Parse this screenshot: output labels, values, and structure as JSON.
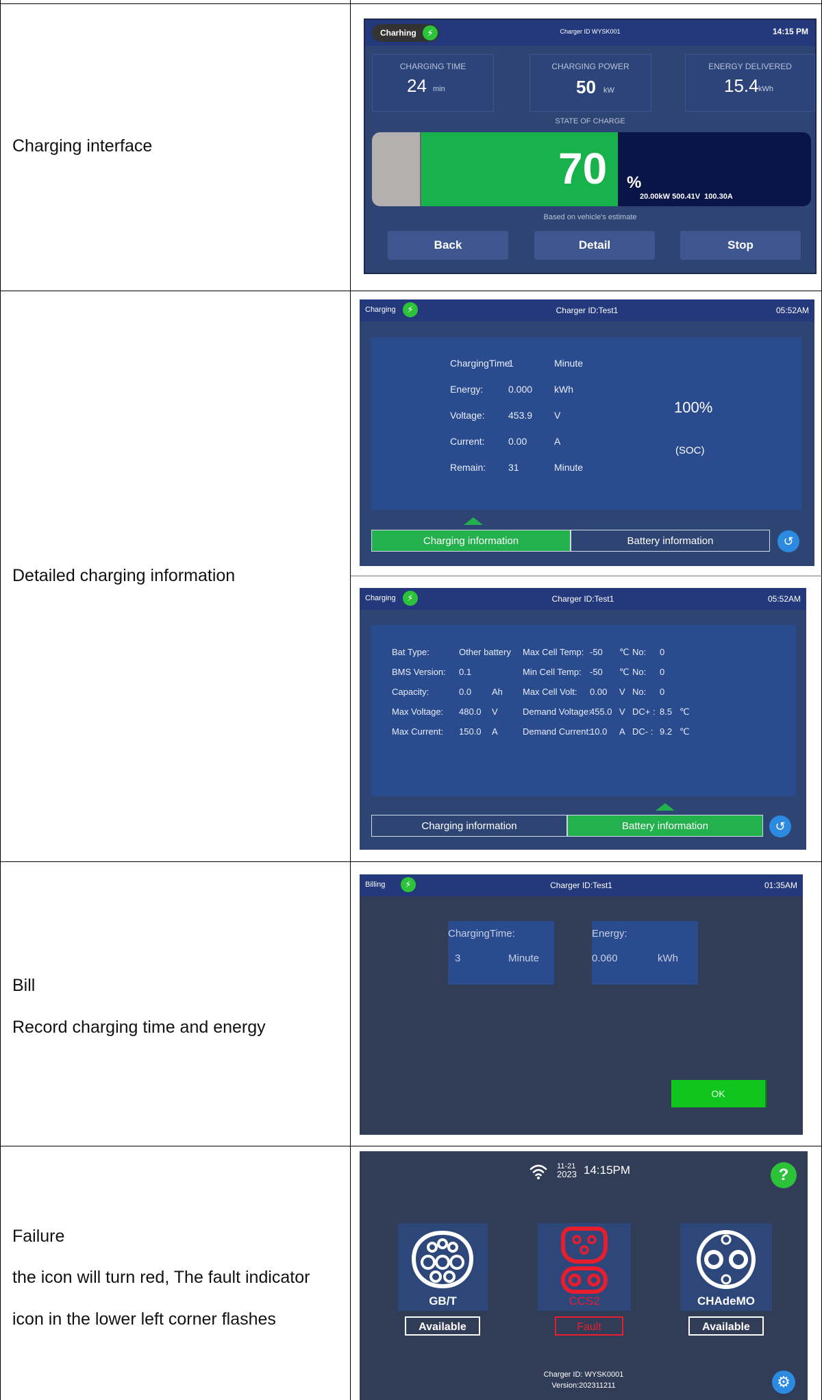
{
  "rows": [
    {
      "labels": [
        "Charging interface"
      ]
    },
    {
      "labels": [
        "Detailed charging information"
      ]
    },
    {
      "labels": [
        "Bill",
        "Record charging time and energy"
      ]
    },
    {
      "labels": [
        "Failure",
        "the icon will turn red, The fault indicator",
        "icon in the lower left corner flashes"
      ]
    }
  ],
  "screen1": {
    "status": "Charhing",
    "charger_id": "Charger ID WYSK001",
    "time": "14:15 PM",
    "cards": [
      {
        "label": "CHARGING TIME",
        "value": "24",
        "unit": "min"
      },
      {
        "label": "CHARGING POWER",
        "value": "50",
        "unit": "kW"
      },
      {
        "label": "ENERGY DELIVERED",
        "value": "15.4",
        "unit": "kWh"
      }
    ],
    "soc_label": "STATE OF CHARGE",
    "soc_value": "70",
    "soc_percent": 70,
    "soc_unit": "%",
    "readings": "20.00kW 500.41V  100.30A",
    "estimate": "Based on vehicle's estimate",
    "buttons": [
      "Back",
      "Detail",
      "Stop"
    ]
  },
  "screen2": {
    "status": "Charging",
    "charger_id": "Charger ID:Test1",
    "time": "05:52AM",
    "rows": [
      {
        "label": "ChargingTime:",
        "value": "1",
        "unit": "Minute"
      },
      {
        "label": "Energy:",
        "value": "0.000",
        "unit": "kWh"
      },
      {
        "label": "Voltage:",
        "value": "453.9",
        "unit": "V"
      },
      {
        "label": "Current:",
        "value": "0.00",
        "unit": "A"
      },
      {
        "label": "Remain:",
        "value": "31",
        "unit": "Minute"
      }
    ],
    "soc": "100%",
    "soc_label": "(SOC)",
    "tab_charging": "Charging information",
    "tab_battery": "Battery information"
  },
  "screen3": {
    "status": "Charging",
    "charger_id": "Charger ID:Test1",
    "time": "05:52AM",
    "left": [
      {
        "label": "Bat Type:",
        "value": "Other battery",
        "unit": ""
      },
      {
        "label": "BMS Version:",
        "value": "0.1",
        "unit": ""
      },
      {
        "label": "Capacity:",
        "value": "0.0",
        "unit": "Ah"
      },
      {
        "label": "Max Voltage:",
        "value": "480.0",
        "unit": "V"
      },
      {
        "label": "Max Current:",
        "value": "150.0",
        "unit": "A"
      }
    ],
    "right": [
      {
        "label": "Max Cell Temp:",
        "value": "-50",
        "unit": "℃",
        "k": "No:",
        "v": "0",
        "u": ""
      },
      {
        "label": "Min Cell Temp:",
        "value": "-50",
        "unit": "℃",
        "k": "No:",
        "v": "0",
        "u": ""
      },
      {
        "label": "Max Cell Volt:",
        "value": "0.00",
        "unit": "V",
        "k": "No:",
        "v": "0",
        "u": ""
      },
      {
        "label": "Demand Voltage:",
        "value": "455.0",
        "unit": "V",
        "k": "DC+ :",
        "v": "8.5",
        "u": "℃"
      },
      {
        "label": "Demand Current:",
        "value": "10.0",
        "unit": "A",
        "k": "DC- :",
        "v": "9.2",
        "u": "℃"
      }
    ],
    "tab_charging": "Charging information",
    "tab_battery": "Battery information"
  },
  "screen4": {
    "status": "Billing",
    "charger_id": "Charger ID:Test1",
    "time": "01:35AM",
    "time_label": "ChargingTime:",
    "time_value": "3",
    "time_unit": "Minute",
    "energy_label": "Energy:",
    "energy_value": "0.060",
    "energy_unit": "kWh",
    "ok": "OK"
  },
  "screen5": {
    "date_top": "11-21",
    "date_year": "2023",
    "time": "14:15PM",
    "help": "?",
    "connectors": [
      {
        "name": "GB/T",
        "status": "Available",
        "fault": false
      },
      {
        "name": "CCS2",
        "status": "Fault",
        "fault": true
      },
      {
        "name": "CHAdeMO",
        "status": "Available",
        "fault": false
      }
    ],
    "charger_id": "Charger ID: WYSK0001",
    "version": "Version:202311211"
  }
}
